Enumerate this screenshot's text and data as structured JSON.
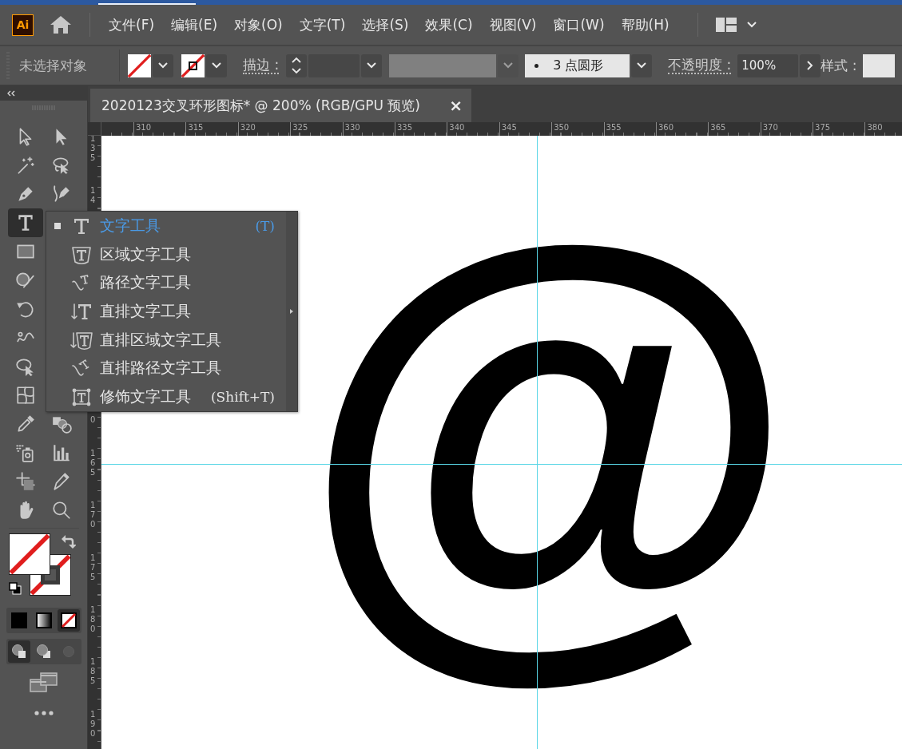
{
  "menu_bar": {
    "logo": "Ai",
    "items": [
      "文件(F)",
      "编辑(E)",
      "对象(O)",
      "文字(T)",
      "选择(S)",
      "效果(C)",
      "视图(V)",
      "窗口(W)",
      "帮助(H)"
    ]
  },
  "control_bar": {
    "selection_label": "未选择对象",
    "fill": {
      "kind": "none"
    },
    "stroke": {
      "kind": "none"
    },
    "stroke_label": "描边 :",
    "width_profile": {
      "disabled": true
    },
    "brush": "3 点圆形",
    "opacity_label": "不透明度 :",
    "opacity": "100%",
    "style_label": "样式 :"
  },
  "document_tab": {
    "title": "2020123交叉环形图标* @ 200% (RGB/GPU 预览)",
    "close": "×"
  },
  "horizontal_ruler": {
    "labels": [
      "310",
      "315",
      "320",
      "325",
      "330",
      "335",
      "340",
      "345",
      "350",
      "355",
      "360",
      "365",
      "370",
      "375",
      "380"
    ]
  },
  "vertical_ruler": {
    "upper_labels": [
      "135",
      "14"
    ],
    "lower_labels": [
      "0",
      "165",
      "170",
      "175",
      "180",
      "185",
      "190"
    ]
  },
  "toolbar": {
    "tool_rows": [
      [
        {
          "kind": "selection",
          "selected": false
        },
        {
          "kind": "direct-selection",
          "selected": false
        }
      ],
      [
        {
          "kind": "magic-wand",
          "selected": false
        },
        {
          "kind": "lasso",
          "selected": false
        }
      ],
      [
        {
          "kind": "pen",
          "selected": false
        },
        {
          "kind": "curvature",
          "selected": false
        }
      ],
      [
        {
          "kind": "type",
          "selected": true
        }
      ],
      [
        {
          "kind": "rectangle",
          "selected": false
        }
      ],
      [
        {
          "kind": "shaper",
          "selected": false
        }
      ],
      [
        {
          "kind": "rotate",
          "selected": false
        }
      ],
      [
        {
          "kind": "width",
          "selected": false
        }
      ],
      [
        {
          "kind": "puppet",
          "selected": false
        }
      ],
      [
        {
          "kind": "mesh",
          "selected": false
        }
      ],
      [
        {
          "kind": "eyedropper",
          "selected": false
        },
        {
          "kind": "shape-builder",
          "selected": false
        }
      ],
      [
        {
          "kind": "sprayer",
          "selected": false
        },
        {
          "kind": "graph",
          "selected": false
        }
      ],
      [
        {
          "kind": "artboard",
          "selected": false
        },
        {
          "kind": "pencil",
          "selected": false
        }
      ],
      [
        {
          "kind": "hand",
          "selected": false
        },
        {
          "kind": "zoom",
          "selected": false
        }
      ]
    ],
    "fill": {
      "kind": "none"
    },
    "stroke": {
      "kind": "none"
    },
    "color_modes": [
      {
        "kind": "color",
        "selected": false
      },
      {
        "kind": "gradient",
        "selected": false
      },
      {
        "kind": "none",
        "selected": true
      }
    ],
    "draw_modes": [
      {
        "kind": "normal",
        "selected": true,
        "disabled": false
      },
      {
        "kind": "behind",
        "selected": false,
        "disabled": false
      },
      {
        "kind": "inside",
        "selected": false,
        "disabled": true
      }
    ]
  },
  "flyout": {
    "items": [
      {
        "kind": "type",
        "label": "文字工具",
        "shortcut": "(T)",
        "selected": true
      },
      {
        "kind": "area-type",
        "label": "区域文字工具",
        "selected": false
      },
      {
        "kind": "path-type",
        "label": "路径文字工具",
        "selected": false
      },
      {
        "kind": "vertical-type",
        "label": "直排文字工具",
        "selected": false
      },
      {
        "kind": "vertical-area-type",
        "label": "直排区域文字工具",
        "selected": false
      },
      {
        "kind": "vertical-path-type",
        "label": "直排路径文字工具",
        "selected": false
      },
      {
        "kind": "touch-type",
        "label": "修饰文字工具",
        "shortcut": "(Shift+T)",
        "selected": false
      }
    ]
  },
  "canvas": {
    "artwork": "@"
  }
}
